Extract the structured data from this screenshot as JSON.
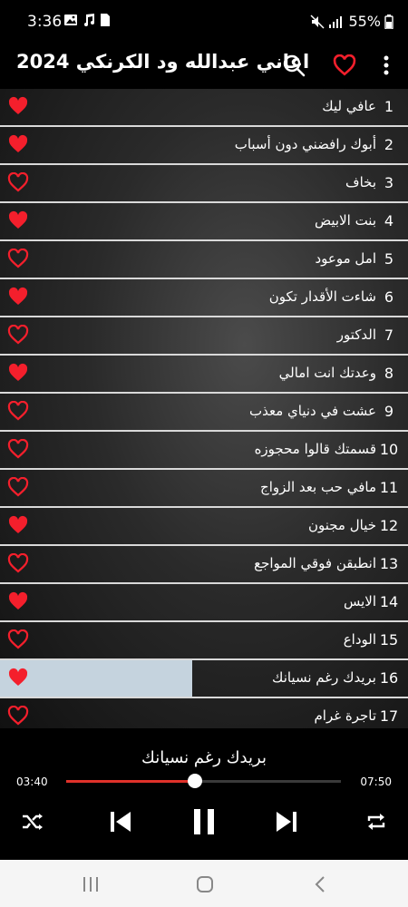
{
  "status": {
    "time": "3:36",
    "battery": "55%"
  },
  "app": {
    "title": "اغاني عبدالله ود الكرنكي 2024"
  },
  "colors": {
    "accent": "#e0312a",
    "heart": "#f41f2c",
    "progress_bg": "#c5d3de"
  },
  "songs": [
    {
      "num": "1",
      "title": "عافي ليك",
      "favorite": true
    },
    {
      "num": "2",
      "title": "أبوك رافضني دون أسباب",
      "favorite": true
    },
    {
      "num": "3",
      "title": "بخاف",
      "favorite": false
    },
    {
      "num": "4",
      "title": "بنت الابيض",
      "favorite": true
    },
    {
      "num": "5",
      "title": "امل موعود",
      "favorite": false
    },
    {
      "num": "6",
      "title": "شاءت الأقدار تكون",
      "favorite": true
    },
    {
      "num": "7",
      "title": "الدكتور",
      "favorite": false
    },
    {
      "num": "8",
      "title": "وعدتك انت امالي",
      "favorite": true
    },
    {
      "num": "9",
      "title": "عشت في دنياي معذب",
      "favorite": false
    },
    {
      "num": "10",
      "title": "قسمتك قالوا محجوزه",
      "favorite": false
    },
    {
      "num": "11",
      "title": "مافي حب بعد الزواج",
      "favorite": false
    },
    {
      "num": "12",
      "title": "خيال مجنون",
      "favorite": true
    },
    {
      "num": "13",
      "title": "انطبقن فوقي المواجع",
      "favorite": false
    },
    {
      "num": "14",
      "title": "الايس",
      "favorite": true
    },
    {
      "num": "15",
      "title": "الوداع",
      "favorite": false
    },
    {
      "num": "16",
      "title": "بريدك رغم نسيانك",
      "favorite": true,
      "playing": true,
      "progress": 0.47
    },
    {
      "num": "17",
      "title": "تاجرة غرام",
      "favorite": false
    }
  ],
  "player": {
    "now_playing": "بريدك رغم نسيانك",
    "elapsed": "03:40",
    "total": "07:50",
    "progress": 0.47
  }
}
